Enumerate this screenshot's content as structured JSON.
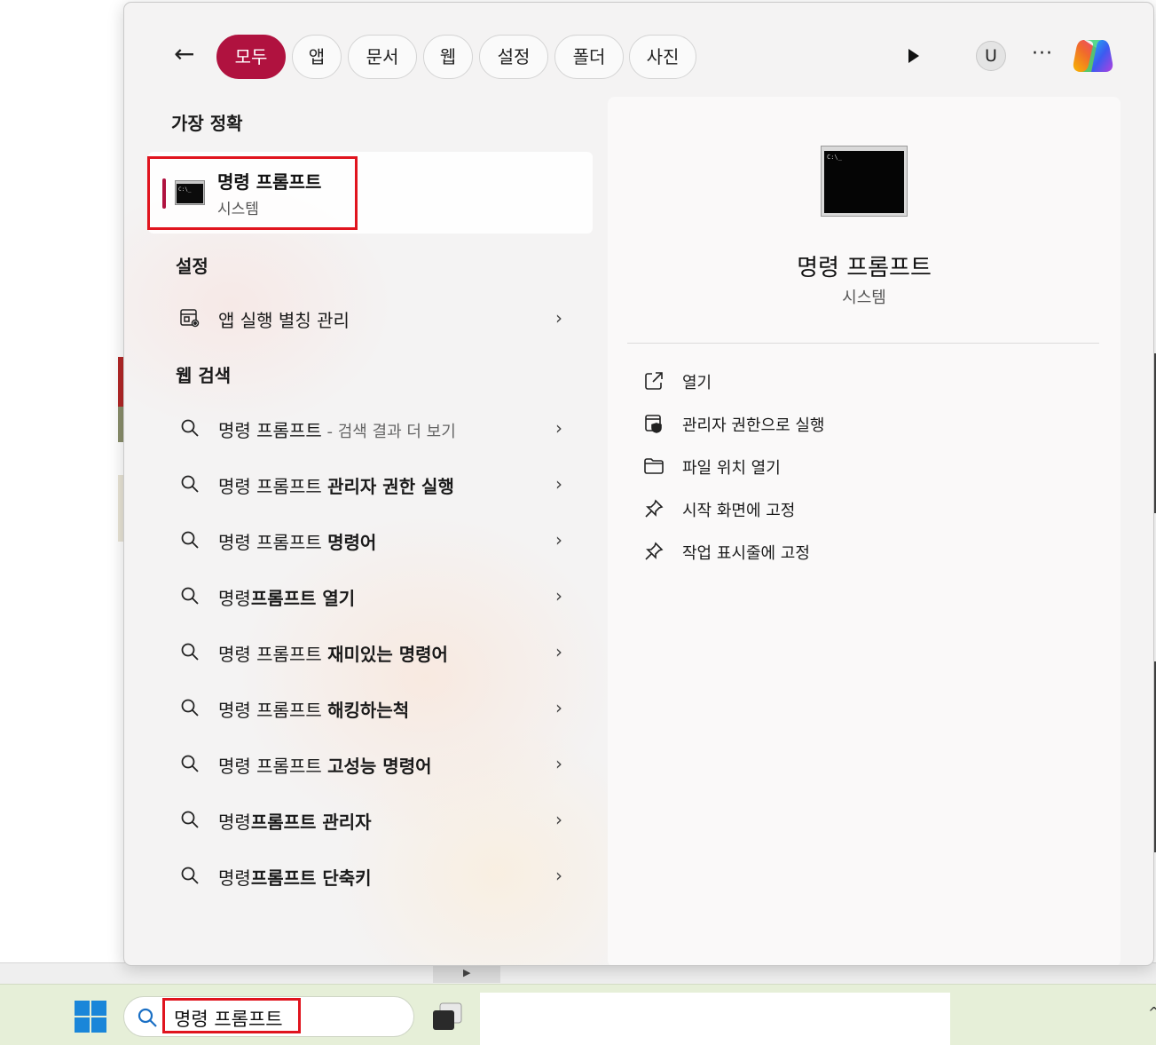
{
  "filters": {
    "back_label": "←",
    "chips": [
      "모두",
      "앱",
      "문서",
      "웹",
      "설정",
      "폴더",
      "사진"
    ],
    "active": "모두",
    "user_initial": "U",
    "more_label": "···"
  },
  "left": {
    "best_match_heading": "가장 정확",
    "best_match": {
      "title": "명령 프롬프트",
      "subtitle": "시스템"
    },
    "settings_heading": "설정",
    "settings_item": "앱 실행 별칭 관리",
    "web_heading": "웹 검색",
    "web_results": [
      {
        "prefix": "명령 프롬프트",
        "bold": "",
        "dim": " - 검색 결과 더 보기"
      },
      {
        "prefix": "명령 프롬프트 ",
        "bold": "관리자 권한 실행",
        "dim": ""
      },
      {
        "prefix": "명령 프롬프트 ",
        "bold": "명령어",
        "dim": ""
      },
      {
        "prefix": "명령",
        "bold": "프롬프트 열기",
        "dim": ""
      },
      {
        "prefix": "명령 프롬프트 ",
        "bold": "재미있는 명령어",
        "dim": ""
      },
      {
        "prefix": "명령 프롬프트 ",
        "bold": "해킹하는척",
        "dim": ""
      },
      {
        "prefix": "명령 프롬프트 ",
        "bold": "고성능 명령어",
        "dim": ""
      },
      {
        "prefix": "명령",
        "bold": "프롬프트 관리자",
        "dim": ""
      },
      {
        "prefix": "명령",
        "bold": "프롬프트 단축키",
        "dim": ""
      }
    ],
    "chevron": "›"
  },
  "preview": {
    "title": "명령 프롬프트",
    "subtitle": "시스템",
    "actions": [
      {
        "icon": "open-external-icon",
        "label": "열기"
      },
      {
        "icon": "shield-admin-icon",
        "label": "관리자 권한으로 실행"
      },
      {
        "icon": "folder-icon",
        "label": "파일 위치 열기"
      },
      {
        "icon": "pin-icon",
        "label": "시작 화면에 고정"
      },
      {
        "icon": "pin-icon",
        "label": "작업 표시줄에 고정"
      }
    ]
  },
  "taskbar": {
    "search_text": "명령 프롬프트"
  },
  "colors": {
    "accent": "#b0123f",
    "highlight": "#e0141e",
    "taskbar": "#e6efd8"
  }
}
